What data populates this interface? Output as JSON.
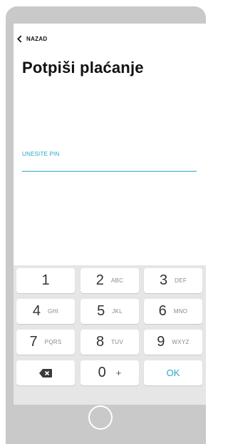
{
  "header": {
    "back_label": "NAZAD",
    "back_icon": "chevron-left-icon"
  },
  "page": {
    "title": "Potpiši plaćanje"
  },
  "pin": {
    "label": "UNESITE PIN",
    "value": ""
  },
  "keypad": {
    "keys": [
      {
        "digit": "1",
        "letters": ""
      },
      {
        "digit": "2",
        "letters": "ABC"
      },
      {
        "digit": "3",
        "letters": "DEF"
      },
      {
        "digit": "4",
        "letters": "GHI"
      },
      {
        "digit": "5",
        "letters": "JKL"
      },
      {
        "digit": "6",
        "letters": "MNO"
      },
      {
        "digit": "7",
        "letters": "PQRS"
      },
      {
        "digit": "8",
        "letters": "TUV"
      },
      {
        "digit": "9",
        "letters": "WXYZ"
      }
    ],
    "backspace_icon": "backspace-icon",
    "zero": {
      "digit": "0",
      "extra": "+"
    },
    "ok_label": "OK"
  },
  "colors": {
    "accent": "#29a9c2",
    "device_frame": "#c9c9c9",
    "keypad_bg": "#e6e6e6"
  }
}
